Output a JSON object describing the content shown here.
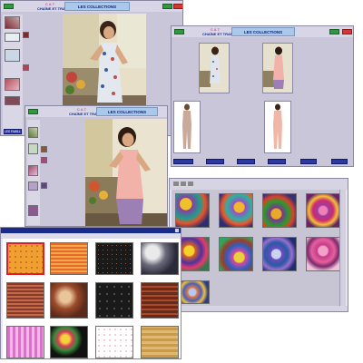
{
  "colors": {
    "window_bg": "#c9c6da",
    "title_bg": "#a9c8ea",
    "title_text": "#0a1f6b",
    "button_green": "#2f9a3d",
    "button_red": "#d93430",
    "button_blue": "#2b3aa0",
    "selection_red": "#d8202a"
  },
  "window1": {
    "title": "LES COLLECTIONS",
    "logo_top": "C A T",
    "logo_bottom": "CHAÎNE ET TRAME",
    "left_button": "LES FAMILLES"
  },
  "window2": {
    "title": "LES COLLECTIONS",
    "logo_top": "C A T",
    "logo_bottom": "CHAÎNE ET TRAME"
  },
  "window3": {
    "title": "LES COLLECTIONS",
    "logo_top": "C A T",
    "logo_bottom": "CHAÎNE ET TRAME",
    "bottom_buttons": [
      "",
      "",
      "",
      "",
      "",
      ""
    ]
  },
  "icons": {
    "toolbar": "toolbar-icon",
    "close": "close-icon",
    "scroll": "scrollbar-icon"
  }
}
